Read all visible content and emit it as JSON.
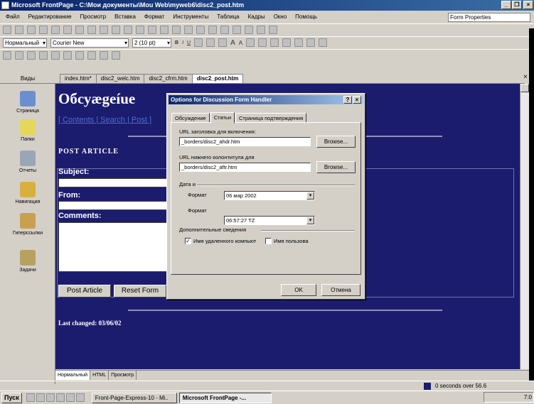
{
  "window": {
    "title": "Microsoft FrontPage - C:\\Мои документы\\Mou Web\\myweb6\\disc2_post.htm"
  },
  "menu": [
    "Файл",
    "Редактирование",
    "Просмотр",
    "Вставка",
    "Формат",
    "Инструменты",
    "Таблица",
    "Кадры",
    "Окно",
    "Помощь"
  ],
  "form_properties": "Form Properties",
  "format_toolbar": {
    "style": "Нормальный",
    "font": "Courier New",
    "size": "2 (10 pt)",
    "bold": "B",
    "italic": "I",
    "underline": "U",
    "font_up": "A",
    "font_down": "A"
  },
  "views": {
    "header": "Виды",
    "items": [
      {
        "label": "Страница",
        "icon": "page-icon"
      },
      {
        "label": "Папки",
        "icon": "folder-icon"
      },
      {
        "label": "Отчеты",
        "icon": "reports-icon"
      },
      {
        "label": "Навигация",
        "icon": "navigation-icon"
      },
      {
        "label": "Гиперссылки",
        "icon": "hyperlinks-icon"
      },
      {
        "label": "Задачи",
        "icon": "tasks-icon"
      }
    ]
  },
  "doc_tabs": [
    "index.htm*",
    "disc2_welc.htm",
    "disc2_cfrm.htm",
    "disc2_post.htm"
  ],
  "page": {
    "heading": "Обсуægeíue",
    "nav_links": "[ Contents | Search | Post ]",
    "post_heading": "POST ARTICLE",
    "subject_label": "Subject:",
    "from_label": "From:",
    "comments_label": "Comments:",
    "post_button": "Post Article",
    "reset_button": "Reset Form",
    "last_changed": "Last changed: 03/06/02"
  },
  "view_tabs": [
    "Нормальный",
    "HTML",
    "Просмотр"
  ],
  "status": {
    "text": "0 seconds over 56.6"
  },
  "dialog": {
    "title": "Options for Discussion Form Handler",
    "tabs": [
      "Обсуждение",
      "Статьи",
      "Страница подтверждения"
    ],
    "header_url_label": "URL заголовка для включения:",
    "header_url_value": "_borders/disc2_ahdr.htm",
    "footer_url_label": "URL нижнего колонтитула для",
    "footer_url_value": "_borders/disc2_aftr.htm",
    "browse1": "Browse...",
    "browse2": "Browse...",
    "date_group": "Дата и",
    "format_label1": "Формат",
    "date_value": "06 мар 2002",
    "format_label2": "Формат",
    "time_value": "06:57:27 TZ",
    "extra_group": "Дополнительные сведения",
    "remote_computer_label": "Имя удаленного компьют",
    "user_name_label": "Имя пользова",
    "remote_checked": true,
    "user_checked": false,
    "ok": "OK",
    "cancel": "Отмена"
  },
  "taskbar": {
    "start": "Пуск",
    "buttons": [
      "Front-Page-Express-10 - Mi..",
      "Microsoft FrontPage -..."
    ],
    "clock": "7:0"
  },
  "colors": {
    "page_bg": "#1c1c6e",
    "titlebar": "#0a246a",
    "link": "#4a6ed0"
  }
}
